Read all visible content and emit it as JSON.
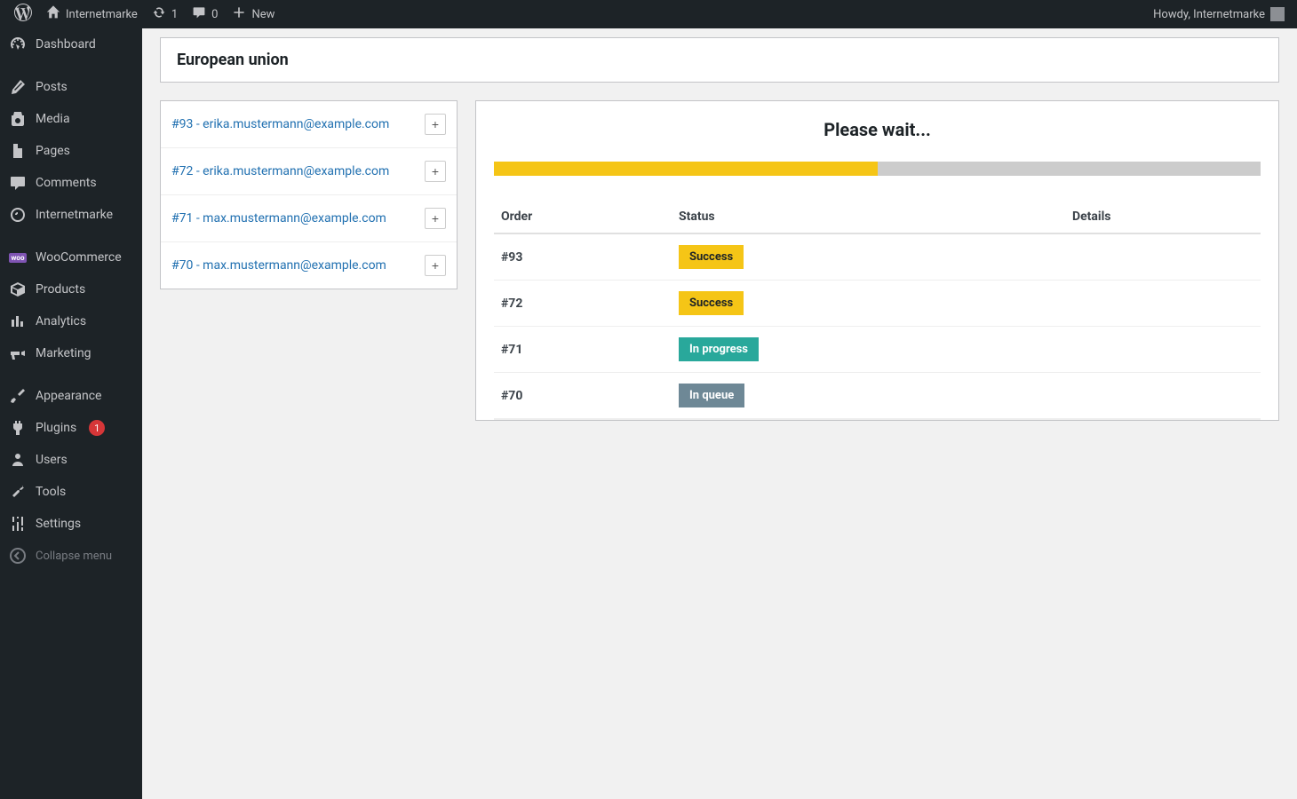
{
  "admin_bar": {
    "site_name": "Internetmarke",
    "updates_count": "1",
    "comments_count": "0",
    "new_label": "New",
    "greeting": "Howdy, Internetmarke"
  },
  "sidebar": {
    "items": [
      {
        "label": "Dashboard"
      },
      {
        "label": "Posts"
      },
      {
        "label": "Media"
      },
      {
        "label": "Pages"
      },
      {
        "label": "Comments"
      },
      {
        "label": "Internetmarke"
      },
      {
        "label": "WooCommerce"
      },
      {
        "label": "Products"
      },
      {
        "label": "Analytics"
      },
      {
        "label": "Marketing"
      },
      {
        "label": "Appearance"
      },
      {
        "label": "Plugins",
        "badge": "1"
      },
      {
        "label": "Users"
      },
      {
        "label": "Tools"
      },
      {
        "label": "Settings"
      }
    ],
    "collapse_label": "Collapse menu"
  },
  "page": {
    "title": "European union"
  },
  "orders_panel": {
    "items": [
      {
        "label": "#93 - erika.mustermann@example.com"
      },
      {
        "label": "#72 - erika.mustermann@example.com"
      },
      {
        "label": "#71 - max.mustermann@example.com"
      },
      {
        "label": "#70 - max.mustermann@example.com"
      }
    ],
    "expand_glyph": "+"
  },
  "status_panel": {
    "heading": "Please wait...",
    "progress_percent": 50,
    "columns": {
      "order": "Order",
      "status": "Status",
      "details": "Details"
    },
    "rows": [
      {
        "order": "#93",
        "status": "Success",
        "status_class": "success"
      },
      {
        "order": "#72",
        "status": "Success",
        "status_class": "success"
      },
      {
        "order": "#71",
        "status": "In progress",
        "status_class": "in-progress"
      },
      {
        "order": "#70",
        "status": "In queue",
        "status_class": "in-queue"
      }
    ]
  }
}
